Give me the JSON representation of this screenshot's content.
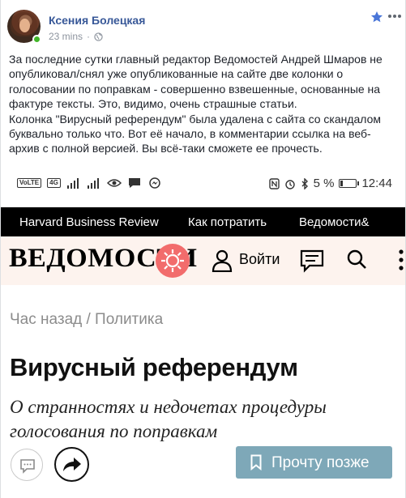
{
  "post": {
    "author": "Ксения Болецкая",
    "time": "23 mins",
    "separator": "·",
    "privacy_icon": "globe-icon",
    "actions": {
      "favorite_icon": "star-icon",
      "more_icon": "more-icon"
    },
    "text_lines": [
      "За последние сутки главный редактор Ведомостей Андрей Шмаров не",
      "опубликовал/снял уже опубликованные на сайте две колонки о",
      "голосовании по поправкам - совершенно взвешенные, основанные на",
      "фактуре тексты. Это, видимо, очень страшные статьи.",
      "Колонка \"Вирусный референдум\" была удалена с сайта со скандалом",
      "буквально только что. Вот её начало, в комментарии ссылка на веб-",
      "архив с полной версией. Вы всё-таки сможете ее прочесть."
    ],
    "colors": {
      "author": "#385898",
      "meta": "#8d949e",
      "online": "#42b72a",
      "favorite": "#4a76d8"
    }
  },
  "status_bar": {
    "badge_1": "VoLTE",
    "badge_2": "4G",
    "battery": "5 %",
    "time": "12:44"
  },
  "site": {
    "nav": [
      "Harvard Business Review",
      "Как потратить",
      "Ведомости&"
    ],
    "logo": "ВЕДОМОСТИ",
    "login": "Войти",
    "breadcrumb": "Час назад / Политика",
    "headline": "Вирусный референдум",
    "subheadline": "О странностях и недочетах процедуры голосования по поправкам",
    "read_later": "Прочту позже",
    "colors": {
      "nav_bg": "#000000",
      "brand_bg": "#fdf3ee",
      "gear": "#f26c6c",
      "button": "#7ea8b8"
    }
  }
}
